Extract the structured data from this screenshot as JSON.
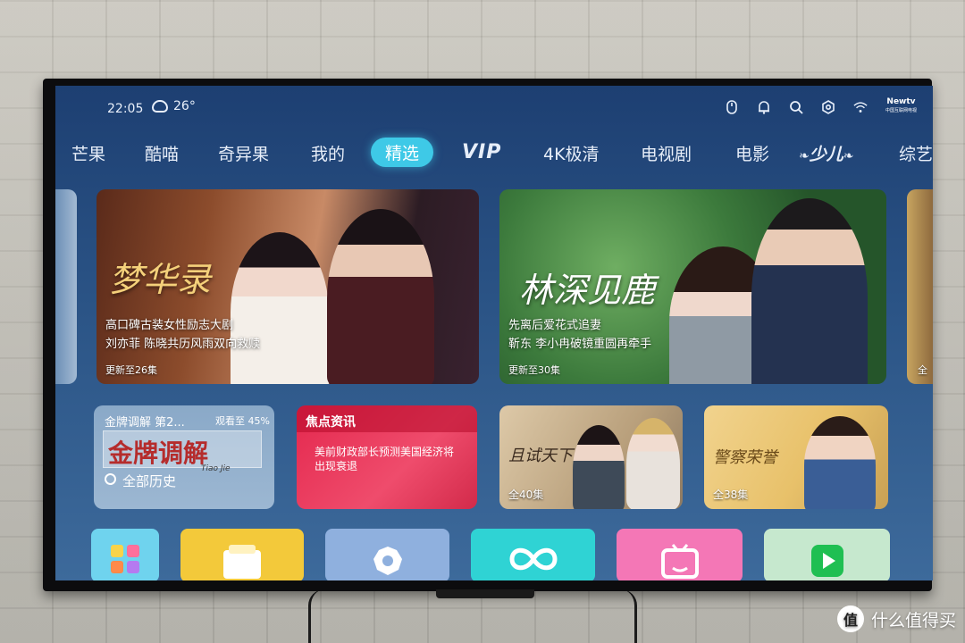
{
  "status": {
    "time": "22:05",
    "temperature": "26°",
    "weather_icon": "cloudy-moon-icon",
    "logo_line1": "Newtv",
    "logo_line2": "中国互联网电视"
  },
  "nav": {
    "items": [
      "芒果",
      "酷喵",
      "奇异果",
      "我的",
      "精选",
      "VIP",
      "4K极清",
      "电视剧",
      "电影",
      "少儿",
      "综艺"
    ],
    "active": "精选"
  },
  "hero": [
    {
      "title": "梦华录",
      "line1": "高口碑古装女性励志大剧",
      "line2": "刘亦菲 陈晓共历风雨双向救赎",
      "episodes": "更新至26集"
    },
    {
      "title": "林深见鹿",
      "line1": "先离后爱花式追妻",
      "line2": "靳东 李小冉破镜重圆再牵手",
      "episodes": "更新至30集"
    },
    {
      "episodes_partial": "全"
    }
  ],
  "history": {
    "show": "金牌调解 第2...",
    "progress": "观看至 45%",
    "brand": "金牌调解",
    "brand_sub": "Tiao Jie",
    "all_label": "全部历史"
  },
  "news": {
    "tag": "焦点资讯",
    "headline": "美前财政部长预测美国经济将出现衰退"
  },
  "shows": [
    {
      "title": "且试天下",
      "episodes": "全40集"
    },
    {
      "title": "警察荣誉",
      "episodes": "全38集"
    }
  ],
  "apps": [
    "app-grid-icon",
    "file-folder-icon",
    "settings-gear-icon",
    "infinity-link-icon",
    "tv-play-icon",
    "video-play-icon"
  ],
  "watermark": {
    "badge": "值",
    "text": "什么值得买"
  }
}
